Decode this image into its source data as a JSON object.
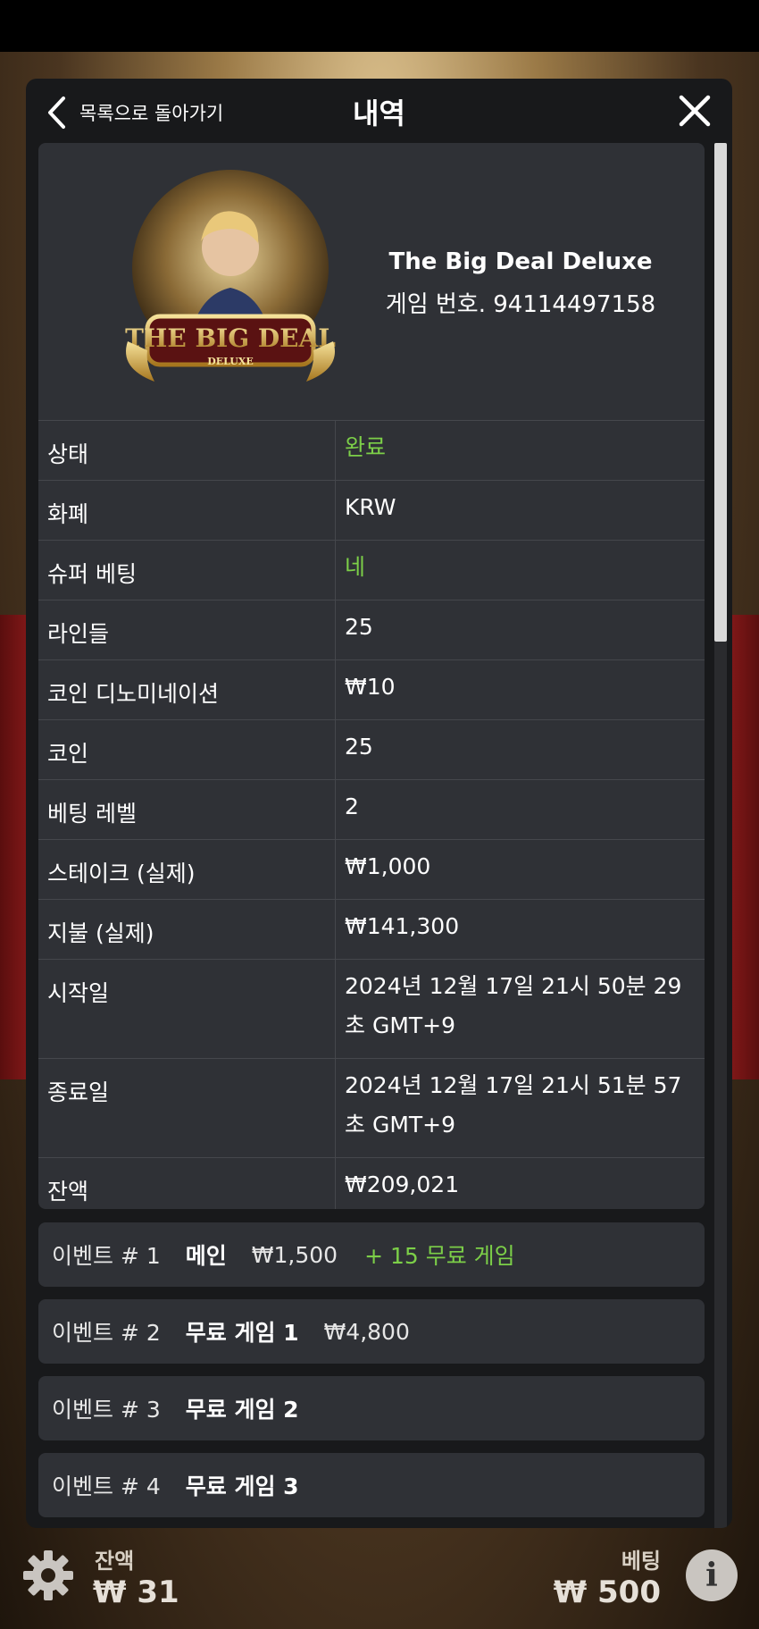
{
  "header": {
    "back_label": "목록으로 돌아가기",
    "title": "내역"
  },
  "game": {
    "name": "The Big Deal Deluxe",
    "number": "게임 번호. 94114497158",
    "logo_text": "THE BIG DEAL",
    "logo_subtext": "DELUXE"
  },
  "details": [
    {
      "key": "상태",
      "value": "완료",
      "color": "#7ccf48"
    },
    {
      "key": "화폐",
      "value": "KRW"
    },
    {
      "key": "슈퍼 베팅",
      "value": "네",
      "color": "#7ccf48"
    },
    {
      "key": "라인들",
      "value": "25"
    },
    {
      "key": "코인 디노미네이션",
      "value": "₩10"
    },
    {
      "key": "코인",
      "value": "25"
    },
    {
      "key": "베팅 레벨",
      "value": "2"
    },
    {
      "key": "스테이크 (실제)",
      "value": "₩1,000"
    },
    {
      "key": "지불 (실제)",
      "value": "₩141,300"
    },
    {
      "key": "시작일",
      "value": "2024년 12월 17일 21시 50분 29초 GMT+9"
    },
    {
      "key": "종료일",
      "value": "2024년 12월 17일 21시 51분 57초 GMT+9"
    },
    {
      "key": "잔액",
      "value": "₩209,021"
    }
  ],
  "events": [
    {
      "num": "이벤트 # 1",
      "type": "메인",
      "amount": "₩1,500",
      "extra": "+ 15 무료 게임"
    },
    {
      "num": "이벤트 # 2",
      "type": "무료 게임 1",
      "amount": "₩4,800",
      "extra": ""
    },
    {
      "num": "이벤트 # 3",
      "type": "무료 게임 2",
      "amount": "",
      "extra": ""
    },
    {
      "num": "이벤트 # 4",
      "type": "무료 게임 3",
      "amount": "",
      "extra": ""
    }
  ],
  "footer": {
    "balance_label": "잔액",
    "balance_value": "₩ 31",
    "bet_label": "베팅",
    "bet_value": "₩ 500",
    "info_glyph": "i"
  },
  "colors": {
    "accent_green": "#7ccf48",
    "modal_bg": "#18191b",
    "card_bg": "#2f3136"
  }
}
